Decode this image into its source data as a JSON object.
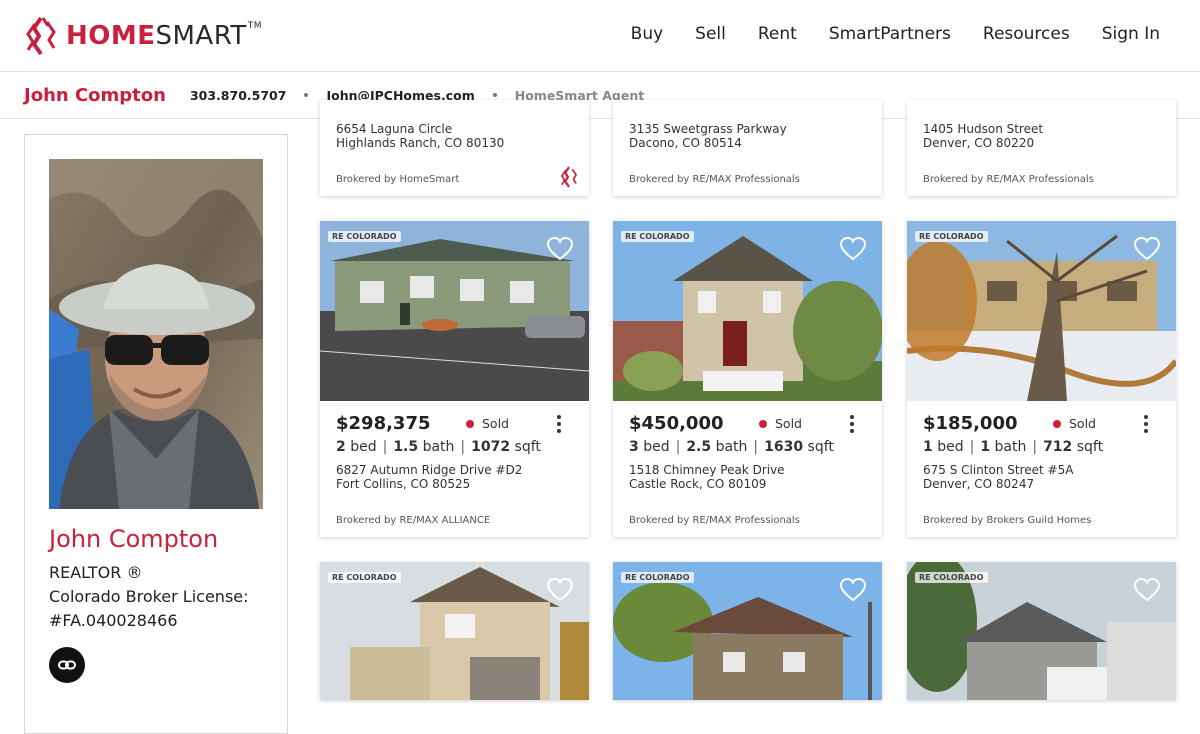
{
  "brand": {
    "home": "HOME",
    "smart": "SMART",
    "tm": "TM",
    "accent": "#c8203d"
  },
  "nav": [
    "Buy",
    "Sell",
    "Rent",
    "SmartPartners",
    "Resources",
    "Sign In"
  ],
  "agent_bar": {
    "name": "John Compton",
    "phone": "303.870.5707",
    "email": "John@JPCHomes.com",
    "role": "HomeSmart Agent"
  },
  "profile": {
    "name": "John Compton",
    "title": "REALTOR ®",
    "license_label": "Colorado Broker License:",
    "license_number": "#FA.040028466"
  },
  "partial_row": [
    {
      "address_line1": "6654 Laguna Circle",
      "address_line2": "Highlands Ranch, CO 80130",
      "broker": "Brokered by HomeSmart"
    },
    {
      "address_line1": "3135 Sweetgrass Parkway",
      "address_line2": "Dacono, CO 80514",
      "broker": "Brokered by RE/MAX Professionals"
    },
    {
      "address_line1": "1405 Hudson Street",
      "address_line2": "Denver, CO 80220",
      "broker": "Brokered by RE/MAX Professionals"
    }
  ],
  "listings": [
    {
      "badge": "RE COLORADO",
      "price": "$298,375",
      "status": "Sold",
      "beds": "2",
      "bed_label": "bed",
      "baths": "1.5",
      "bath_label": "bath",
      "sqft": "1072",
      "sqft_label": "sqft",
      "address_line1": "6827 Autumn Ridge Drive #D2",
      "address_line2": "Fort Collins, CO 80525",
      "broker": "Brokered by RE/MAX ALLIANCE"
    },
    {
      "badge": "RE COLORADO",
      "price": "$450,000",
      "status": "Sold",
      "beds": "3",
      "bed_label": "bed",
      "baths": "2.5",
      "bath_label": "bath",
      "sqft": "1630",
      "sqft_label": "sqft",
      "address_line1": "1518 Chimney Peak Drive",
      "address_line2": "Castle Rock, CO 80109",
      "broker": "Brokered by RE/MAX Professionals"
    },
    {
      "badge": "RE COLORADO",
      "price": "$185,000",
      "status": "Sold",
      "beds": "1",
      "bed_label": "bed",
      "baths": "1",
      "bath_label": "bath",
      "sqft": "712",
      "sqft_label": "sqft",
      "address_line1": "675 S Clinton Street #5A",
      "address_line2": "Denver, CO 80247",
      "broker": "Brokered by Brokers Guild Homes"
    }
  ],
  "bottom_row": [
    {
      "badge": "RE COLORADO"
    },
    {
      "badge": "RE COLORADO"
    },
    {
      "badge": "RE COLORADO"
    }
  ]
}
